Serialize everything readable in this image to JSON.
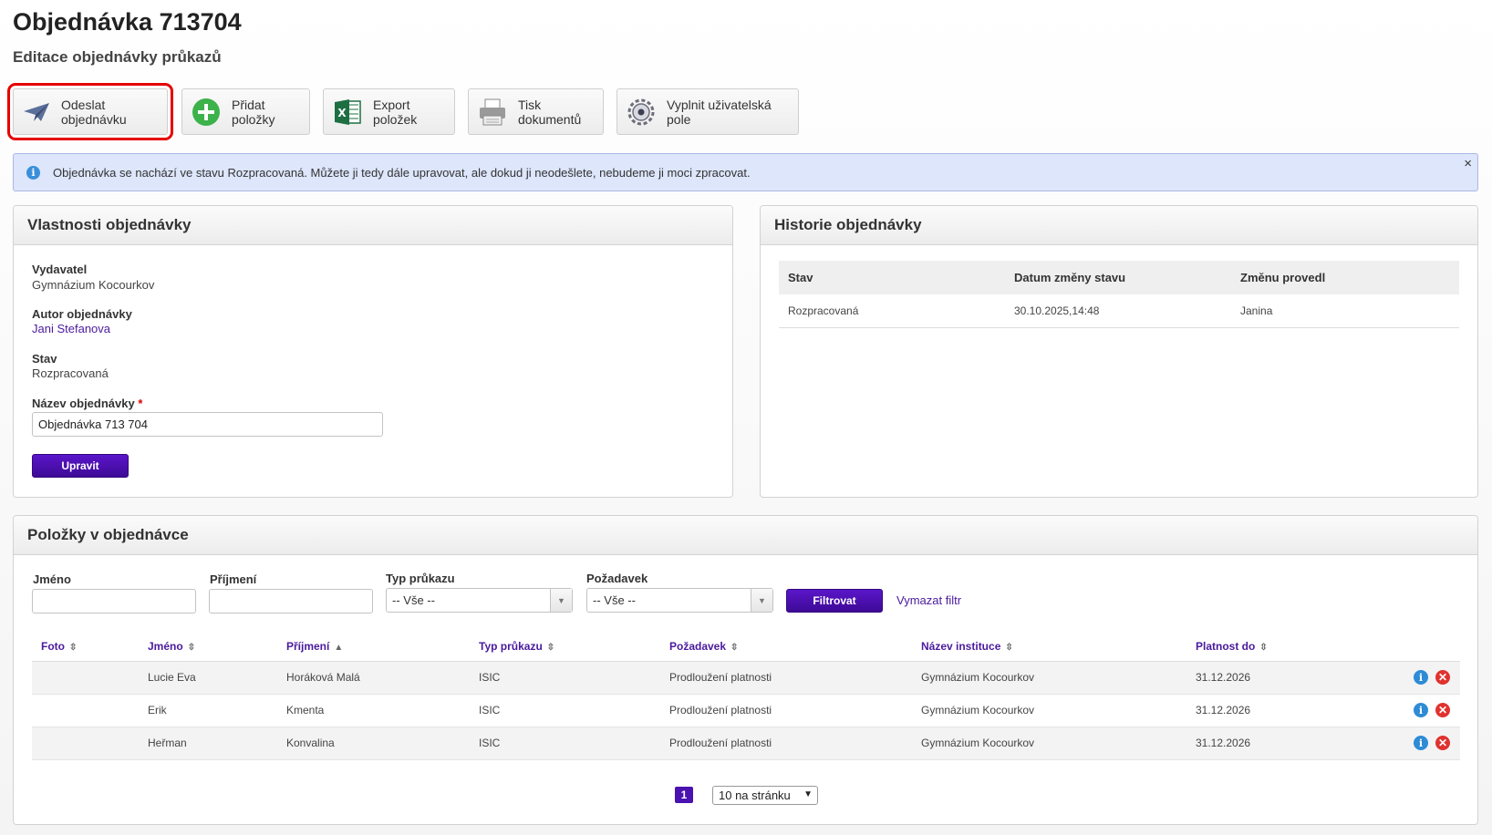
{
  "header": {
    "title": "Objednávka 713704",
    "subtitle": "Editace objednávky průkazů"
  },
  "toolbar": {
    "buttons": [
      {
        "label": "Odeslat objednávku",
        "icon": "paper-plane-icon"
      },
      {
        "label": "Přidat položky",
        "icon": "plus-circle-icon"
      },
      {
        "label": "Export položek",
        "icon": "excel-icon"
      },
      {
        "label": "Tisk dokumentů",
        "icon": "printer-icon"
      },
      {
        "label": "Vyplnit uživatelská pole",
        "icon": "gear-icon"
      }
    ]
  },
  "alert": {
    "text": "Objednávka se nachází ve stavu Rozpracovaná. Můžete ji tedy dále upravovat, ale dokud ji neodešlete, nebudeme ji moci zpracovat.",
    "close": "×"
  },
  "properties": {
    "heading": "Vlastnosti objednávky",
    "publisher_label": "Vydavatel",
    "publisher_value": "Gymnázium Kocourkov",
    "author_label": "Autor objednávky",
    "author_value": "Jani Stefanova",
    "state_label": "Stav",
    "state_value": "Rozpracovaná",
    "name_label": "Název objednávky",
    "required_mark": "*",
    "name_value": "Objednávka 713 704",
    "submit_label": "Upravit"
  },
  "history": {
    "heading": "Historie objednávky",
    "columns": [
      "Stav",
      "Datum změny stavu",
      "Změnu provedl"
    ],
    "rows": [
      [
        "Rozpracovaná",
        "30.10.2025,14:48",
        "Janina"
      ]
    ]
  },
  "items": {
    "heading": "Položky v objednávce",
    "filters": {
      "first_name_label": "Jméno",
      "last_name_label": "Příjmení",
      "card_type_label": "Typ průkazu",
      "card_type_value": "-- Vše --",
      "request_label": "Požadavek",
      "request_value": "-- Vše --",
      "filter_button": "Filtrovat",
      "clear_link": "Vymazat filtr"
    },
    "columns": [
      "Foto",
      "Jméno",
      "Příjmení",
      "Typ průkazu",
      "Požadavek",
      "Název instituce",
      "Platnost do"
    ],
    "sort_icons": [
      "⇳",
      "⇳",
      "▲",
      "⇳",
      "⇳",
      "⇳",
      "⇳"
    ],
    "rows": [
      [
        "",
        "Lucie Eva",
        "Horáková Malá",
        "ISIC",
        "Prodloužení platnosti",
        "Gymnázium Kocourkov",
        "31.12.2026"
      ],
      [
        "",
        "Erik",
        "Kmenta",
        "ISIC",
        "Prodloužení platnosti",
        "Gymnázium Kocourkov",
        "31.12.2026"
      ],
      [
        "",
        "Heřman",
        "Konvalina",
        "ISIC",
        "Prodloužení platnosti",
        "Gymnázium Kocourkov",
        "31.12.2026"
      ]
    ],
    "action_info": "i",
    "action_delete": "✕",
    "pager": {
      "current_page": "1",
      "per_page": "10 na stránku"
    }
  }
}
